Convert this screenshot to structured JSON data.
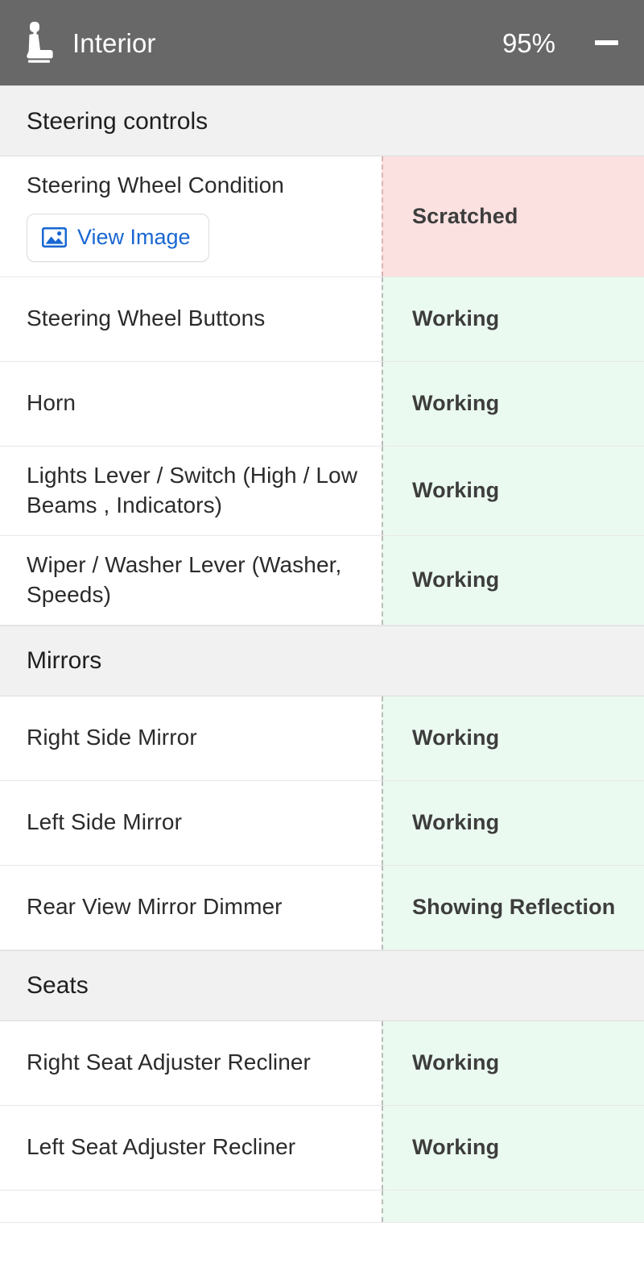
{
  "header": {
    "icon": "car-seat-icon",
    "title": "Interior",
    "percent": "95%",
    "collapse_icon": "minus-icon",
    "bg_color": "#686868",
    "text_color": "#ffffff"
  },
  "colors": {
    "section_header_bg": "#F1F1F1",
    "status_ok_bg": "#EBFAF0",
    "status_bad_bg": "#FCE1E1",
    "link_blue": "#1967D2",
    "divider": "#b9bcb9"
  },
  "sections": [
    {
      "title": "Steering controls",
      "rows": [
        {
          "label": "Steering Wheel Condition",
          "value": "Scratched",
          "status": "bad",
          "has_button": true,
          "button_label": "View Image",
          "button_icon": "image-icon"
        },
        {
          "label": "Steering Wheel Buttons",
          "value": "Working",
          "status": "ok",
          "has_button": false
        },
        {
          "label": "Horn",
          "value": "Working",
          "status": "ok",
          "has_button": false
        },
        {
          "label": "Lights Lever / Switch (High / Low Beams , Indicators)",
          "value": "Working",
          "status": "ok",
          "has_button": false
        },
        {
          "label": "Wiper / Washer Lever (Washer, Speeds)",
          "value": "Working",
          "status": "ok",
          "has_button": false
        }
      ]
    },
    {
      "title": "Mirrors",
      "rows": [
        {
          "label": "Right Side Mirror",
          "value": "Working",
          "status": "ok",
          "has_button": false
        },
        {
          "label": "Left Side Mirror",
          "value": "Working",
          "status": "ok",
          "has_button": false
        },
        {
          "label": "Rear View Mirror Dimmer",
          "value": "Showing Reflection",
          "status": "ok",
          "has_button": false
        }
      ]
    },
    {
      "title": "Seats",
      "rows": [
        {
          "label": "Right Seat Adjuster Recliner",
          "value": "Working",
          "status": "ok",
          "has_button": false
        },
        {
          "label": "Left Seat Adjuster Recliner",
          "value": "Working",
          "status": "ok",
          "has_button": false
        },
        {
          "label": "",
          "value": "",
          "status": "ok",
          "has_button": false,
          "partial": true
        }
      ]
    }
  ]
}
